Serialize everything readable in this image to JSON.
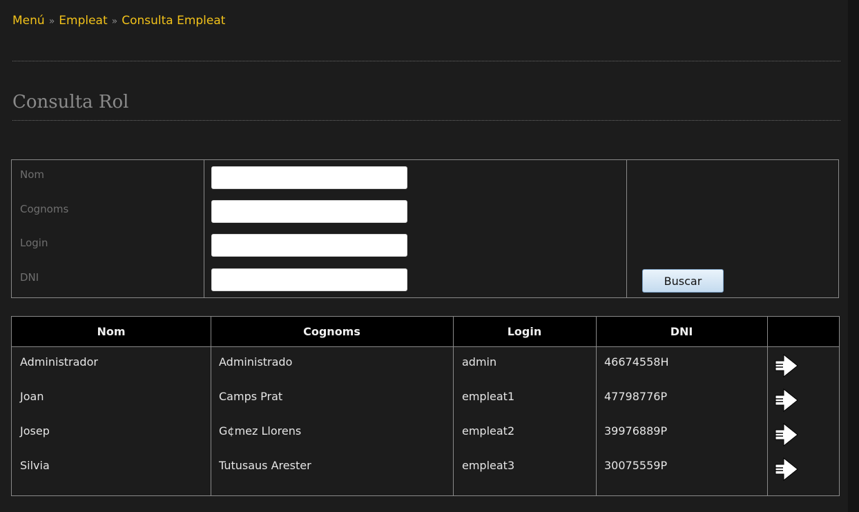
{
  "breadcrumb": {
    "items": [
      "Menú",
      "Empleat",
      "Consulta Empleat"
    ],
    "separator": "»"
  },
  "page": {
    "title": "Consulta Rol"
  },
  "search": {
    "labels": [
      "Nom",
      "Cognoms",
      "Login",
      "DNI"
    ],
    "values": [
      "",
      "",
      "",
      ""
    ],
    "button": "Buscar"
  },
  "results": {
    "columns": [
      "Nom",
      "Cognoms",
      "Login",
      "DNI",
      ""
    ],
    "rows": [
      {
        "nom": "Administrador",
        "cognoms": "Administrado",
        "login": "admin",
        "dni": "46674558H",
        "action_icon": "arrow-right-icon"
      },
      {
        "nom": "Joan",
        "cognoms": "Camps Prat",
        "login": "empleat1",
        "dni": "47798776P",
        "action_icon": "arrow-right-icon"
      },
      {
        "nom": "Josep",
        "cognoms": "G¢mez Llorens",
        "login": "empleat2",
        "dni": "39976889P",
        "action_icon": "arrow-right-icon"
      },
      {
        "nom": "Silvia",
        "cognoms": "Tutusaus Arester",
        "login": "empleat3",
        "dni": "30075559P",
        "action_icon": "arrow-right-icon"
      }
    ]
  },
  "colors": {
    "background": "#1c1c1c",
    "breadcrumb_link": "#f2c21a",
    "muted_text": "#8a8a8a",
    "table_header_bg": "#000000",
    "border": "#8a8a8a"
  }
}
